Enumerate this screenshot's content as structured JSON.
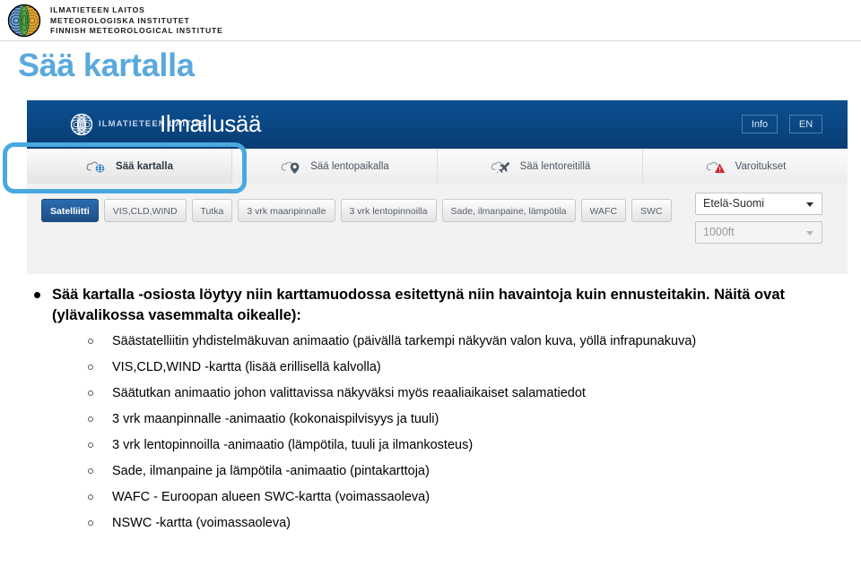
{
  "masthead": {
    "logo_icon": "fmi-globe-logo-icon",
    "lines": [
      "ILMATIETEEN LAITOS",
      "METEOROLOGISKA INSTITUTET",
      "FINNISH METEOROLOGICAL INSTITUTE"
    ]
  },
  "slide": {
    "title": "Sää kartalla",
    "title_color": "#5aa9de"
  },
  "app": {
    "header": {
      "logo_icon": "fmi-globe-logo-white-icon",
      "org": "ILMATIETEEN LAITOS",
      "brand": "Ilmailusää",
      "info_button": "Info",
      "lang_button": "EN",
      "background_color": "#0a4682"
    },
    "tabs": [
      {
        "label": "Sää kartalla",
        "icon": "cloud-globe-icon",
        "active": true
      },
      {
        "label": "Sää lentopaikalla",
        "icon": "cloud-pin-icon",
        "active": false
      },
      {
        "label": "Sää lentoreitillä",
        "icon": "cloud-plane-icon",
        "active": false
      },
      {
        "label": "Varoitukset",
        "icon": "cloud-warning-triangle-icon",
        "active": false
      }
    ],
    "highlight": {
      "target": "tab-saa-kartalla",
      "color": "#49a8e0"
    },
    "layer_buttons": [
      {
        "label": "Satelliitti",
        "active": true
      },
      {
        "label": "VIS,CLD,WIND",
        "active": false
      },
      {
        "label": "Tutka",
        "active": false
      },
      {
        "label": "3 vrk maanpinnalle",
        "active": false
      },
      {
        "label": "3 vrk lentopinnoilla",
        "active": false
      },
      {
        "label": "Sade, ilmanpaine, lämpötila",
        "active": false
      },
      {
        "label": "WAFC",
        "active": false
      },
      {
        "label": "SWC",
        "active": false
      }
    ],
    "selects": {
      "region": {
        "value": "Etelä-Suomi",
        "disabled": false
      },
      "level": {
        "value": "1000ft",
        "disabled": true
      }
    },
    "active_button_color": "#1d4f86"
  },
  "content": {
    "lead_bullet": "Sää kartalla -osiosta löytyy niin karttamuodossa esitettynä niin havaintoja kuin ennusteitakin. Näitä ovat (ylävalikossa vasemmalta oikealle):",
    "sub_items": [
      "Säästatelliitin yhdistelmäkuvan animaatio (päivällä tarkempi näkyvän valon kuva, yöllä infrapunakuva)",
      "VIS,CLD,WIND -kartta (lisää erillisellä kalvolla)",
      "Säätutkan animaatio johon valittavissa näkyväksi myös reaaliaikaiset salamatiedot",
      "3 vrk maanpinnalle -animaatio (kokonaispilvisyys ja tuuli)",
      "3 vrk lentopinnoilla -animaatio (lämpötila, tuuli ja ilmankosteus)",
      "Sade, ilmanpaine ja lämpötila -animaatio (pintakarttoja)",
      "WAFC - Euroopan alueen SWC-kartta (voimassaoleva)",
      "NSWC -kartta (voimassaoleva)"
    ]
  }
}
